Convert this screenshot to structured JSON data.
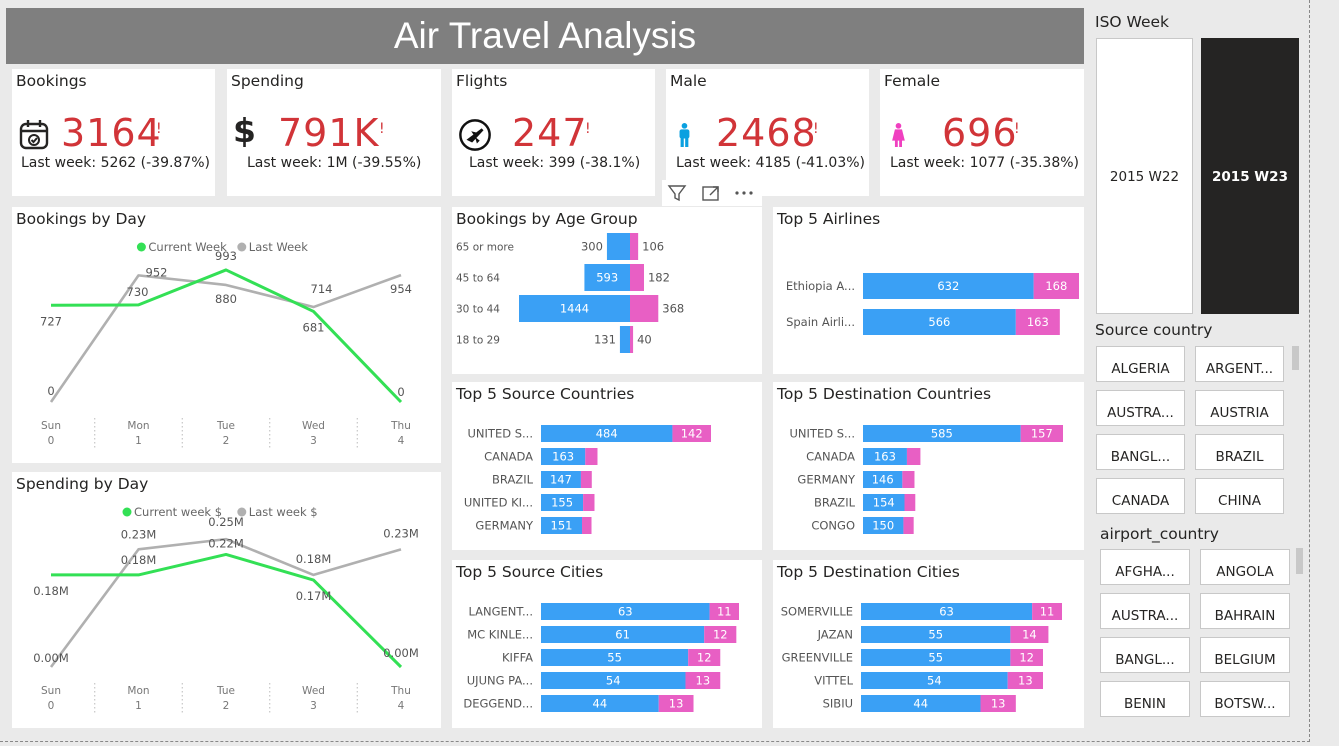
{
  "page": {
    "title": "Air Travel Analysis"
  },
  "kpis": [
    {
      "title": "Bookings",
      "value": "3164",
      "bang": "!",
      "sub": "Last week: 5262 (-39.87%)",
      "icon": "calendar-check-icon"
    },
    {
      "title": "Spending",
      "value": "791K",
      "bang": "!",
      "sub": "Last week: 1M (-39.55%)",
      "icon": "dollar-icon"
    },
    {
      "title": "Flights",
      "value": "247",
      "bang": "!",
      "sub": "Last week: 399 (-38.1%)",
      "icon": "airplane-icon"
    },
    {
      "title": "Male",
      "value": "2468",
      "bang": "!",
      "sub": "Last week: 4185 (-41.03%)",
      "icon": "male-icon"
    },
    {
      "title": "Female",
      "value": "696",
      "bang": "!",
      "sub": "Last week: 1077 (-35.38%)",
      "icon": "female-icon"
    }
  ],
  "colors": {
    "current": "#33e055",
    "last": "#b0b0b0",
    "male": "#3aa0f5",
    "female": "#e85fc4",
    "kpi": "#d13438",
    "male_icon": "#0aa0e0",
    "female_icon": "#f040c0"
  },
  "chart_data": [
    {
      "type": "line",
      "title": "Bookings by Day",
      "categories": [
        "Sun",
        "Mon",
        "Tue",
        "Wed",
        "Thu"
      ],
      "category_index": [
        "0",
        "1",
        "2",
        "3",
        "4"
      ],
      "series": [
        {
          "name": "Current Week",
          "values": [
            727,
            730,
            993,
            681,
            0
          ],
          "labels": [
            "727",
            "730",
            "993",
            "681",
            "0"
          ]
        },
        {
          "name": "Last Week",
          "values": [
            0,
            952,
            880,
            714,
            954
          ],
          "labels": [
            "0",
            "952",
            "880",
            "714",
            "954"
          ]
        }
      ],
      "ylim": [
        0,
        1000
      ],
      "legend": "top-center"
    },
    {
      "type": "line",
      "title": "Spending by Day",
      "categories": [
        "Sun",
        "Mon",
        "Tue",
        "Wed",
        "Thu"
      ],
      "category_index": [
        "0",
        "1",
        "2",
        "3",
        "4"
      ],
      "series": [
        {
          "name": "Current week $",
          "values": [
            0.18,
            0.18,
            0.22,
            0.17,
            0.0
          ],
          "labels": [
            "0.18M",
            "0.18M",
            "0.22M",
            "0.17M",
            "0.00M"
          ]
        },
        {
          "name": "Last week $",
          "values": [
            0.0,
            0.23,
            0.25,
            0.18,
            0.23
          ],
          "labels": [
            "0.00M",
            "0.23M",
            "0.25M",
            "0.18M",
            "0.23M"
          ]
        }
      ],
      "ylim": [
        0,
        0.26
      ],
      "legend": "top-center"
    },
    {
      "type": "bar",
      "title": "Bookings by Age Group",
      "orientation": "butterfly",
      "categories": [
        "65 or more",
        "45 to 64",
        "30 to 44",
        "18 to 29"
      ],
      "series": [
        {
          "name": "Male",
          "values": [
            300,
            593,
            1444,
            131
          ]
        },
        {
          "name": "Female",
          "values": [
            106,
            182,
            368,
            40
          ]
        }
      ]
    },
    {
      "type": "bar",
      "title": "Top 5 Airlines",
      "stacked": true,
      "categories": [
        "Ethiopia A...",
        "Spain Airli..."
      ],
      "series": [
        {
          "name": "Male",
          "values": [
            632,
            566
          ]
        },
        {
          "name": "Female",
          "values": [
            168,
            163
          ]
        }
      ]
    },
    {
      "type": "bar",
      "title": "Top 5 Source Countries",
      "stacked": true,
      "categories": [
        "UNITED S...",
        "CANADA",
        "BRAZIL",
        "UNITED KI...",
        "GERMANY"
      ],
      "series": [
        {
          "name": "Male",
          "values": [
            484,
            163,
            147,
            155,
            151
          ]
        },
        {
          "name": "Female",
          "values": [
            142,
            45,
            40,
            42,
            35
          ]
        }
      ],
      "show_female_label": [
        true,
        false,
        false,
        false,
        false
      ]
    },
    {
      "type": "bar",
      "title": "Top 5 Destination Countries",
      "stacked": true,
      "categories": [
        "UNITED S...",
        "CANADA",
        "GERMANY",
        "BRAZIL",
        "CONGO"
      ],
      "series": [
        {
          "name": "Male",
          "values": [
            585,
            163,
            146,
            154,
            150
          ]
        },
        {
          "name": "Female",
          "values": [
            157,
            50,
            45,
            40,
            38
          ]
        }
      ],
      "show_female_label": [
        true,
        false,
        false,
        false,
        false
      ]
    },
    {
      "type": "bar",
      "title": "Top 5 Source Cities",
      "stacked": true,
      "categories": [
        "LANGENT...",
        "MC KINLE...",
        "KIFFA",
        "UJUNG PA...",
        "DEGGEND..."
      ],
      "series": [
        {
          "name": "Male",
          "values": [
            63,
            61,
            55,
            54,
            44
          ]
        },
        {
          "name": "Female",
          "values": [
            11,
            12,
            12,
            13,
            13
          ]
        }
      ]
    },
    {
      "type": "bar",
      "title": "Top 5 Destination Cities",
      "stacked": true,
      "categories": [
        "SOMERVILLE",
        "JAZAN",
        "GREENVILLE",
        "VITTEL",
        "SIBIU"
      ],
      "series": [
        {
          "name": "Male",
          "values": [
            63,
            55,
            55,
            54,
            44
          ]
        },
        {
          "name": "Female",
          "values": [
            11,
            14,
            12,
            13,
            13
          ]
        }
      ]
    }
  ],
  "slicers": {
    "iso_week": {
      "title": "ISO Week",
      "options": [
        "2015 W22",
        "2015 W23"
      ],
      "selected": "2015 W23"
    },
    "source_country": {
      "title": "Source country",
      "options": [
        "ALGERIA",
        "ARGENT...",
        "AUSTRA...",
        "AUSTRIA",
        "BANGL...",
        "BRAZIL",
        "CANADA",
        "CHINA"
      ]
    },
    "airport_country": {
      "title": "airport_country",
      "options": [
        "AFGHA...",
        "ANGOLA",
        "AUSTRA...",
        "BAHRAIN",
        "BANGL...",
        "BELGIUM",
        "BENIN",
        "BOTSW..."
      ]
    }
  },
  "visual_header": {
    "icons": [
      "filter-icon",
      "focus-mode-icon",
      "more-options-icon"
    ]
  }
}
